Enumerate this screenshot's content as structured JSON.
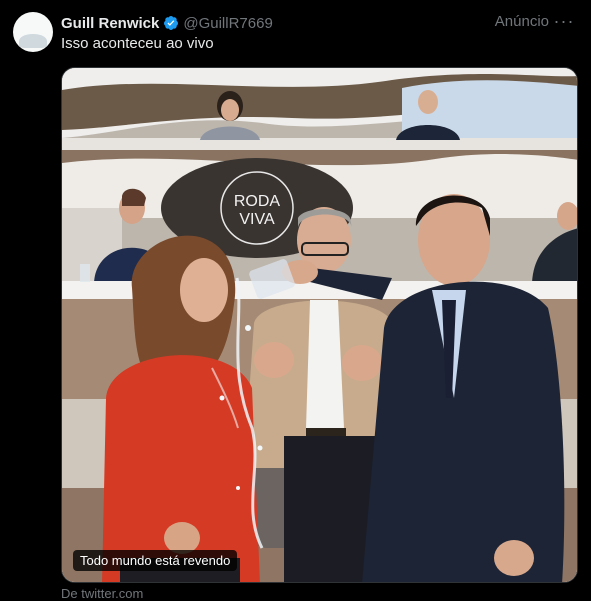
{
  "post": {
    "author_name": "Guill Renwick",
    "verified": true,
    "handle": "@GuillR7669",
    "ad_label": "Anúncio",
    "more_glyph": "···",
    "text": "Isso aconteceu ao vivo",
    "media": {
      "caption": "Todo mundo está revendo",
      "logo_text": [
        "RODA",
        "VIVA"
      ]
    },
    "source": "De twitter.com"
  },
  "colors": {
    "background": "#000000",
    "verified_badge": "#1d9bf0",
    "muted_text": "#71767b"
  }
}
